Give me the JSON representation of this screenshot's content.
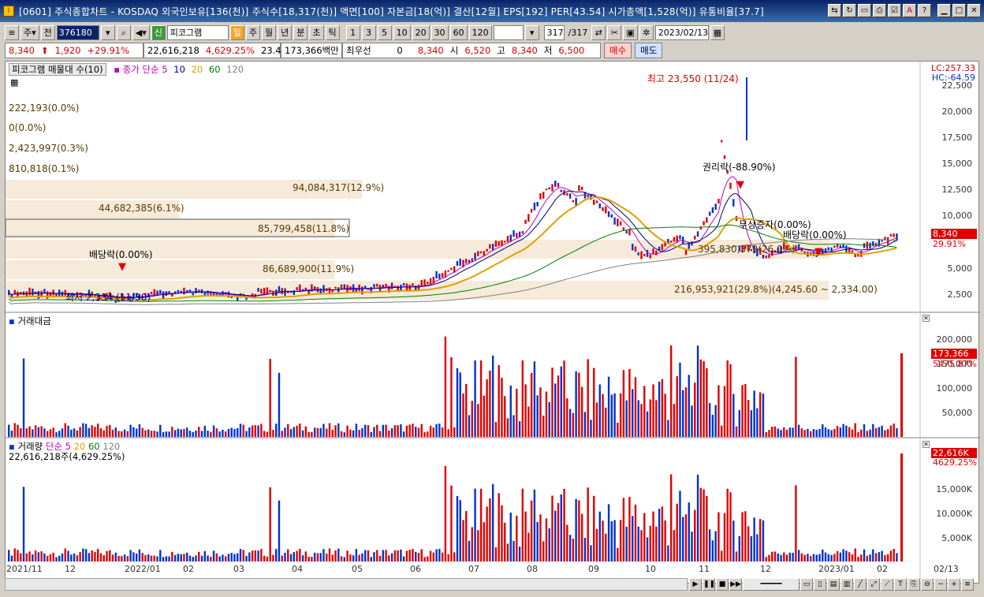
{
  "window": {
    "title": "[0601] 주식종합차트 - KOSDAQ 외국인보유[136(천)] 주식수[18,317(천)] 액면[100] 자본금[18(억)] 결산[12월] EPS[192] PER[43.54] 시가총액[1,528(억)] 유통비율[37.7]"
  },
  "toolbar": {
    "market_label": "주",
    "all_label": "전",
    "code": "376180",
    "program_label": "피코그램",
    "periods": [
      "일",
      "주",
      "월",
      "년",
      "분",
      "초",
      "틱"
    ],
    "intervals": [
      "1",
      "3",
      "5",
      "10",
      "20",
      "30",
      "60",
      "120"
    ],
    "count": "317",
    "count_total": "/317",
    "date": "2023/02/13"
  },
  "quote": {
    "price": "8,340",
    "change": "1,920",
    "change_pct": "+29.91%",
    "volume": "22,616,218",
    "volume_pct": "4,629.25%",
    "turnover": "23.47%",
    "trade_value": "173,366백만",
    "best_bid_label": "최우선",
    "best_bid": "0",
    "current": "8,340",
    "open_label": "시",
    "open": "6,520",
    "high_label": "고",
    "high": "8,340",
    "low_label": "저",
    "low": "6,500",
    "buy_label": "매수",
    "sell_label": "매도"
  },
  "price_panel": {
    "vp_legend": "피코그램 매물대 수(10)",
    "ma_legend": "종가 단순 5",
    "ma_periods": [
      "10",
      "20",
      "60",
      "120"
    ],
    "lc": "LC:257.33",
    "hc": "HC:-64.59",
    "price_badge": "8,340",
    "pct_badge": "29.91%",
    "indicators": [
      "222,193(0.0%)",
      "0(0.0%)",
      "2,423,997(0.3%)",
      "810,818(0.1%)"
    ],
    "volume_profile": [
      {
        "label": "94,084,317(12.9%)",
        "fill": 0.39
      },
      {
        "label": "44,682,385(6.1%)",
        "fill": 0.19
      },
      {
        "label": "85,799,458(11.8%)",
        "fill": 0.36
      },
      {
        "label": "395,830,379(26.0%)",
        "fill": 0.9
      },
      {
        "label": "86,689,900(11.9%)",
        "fill": 0.36
      },
      {
        "label": "216,953,921(29.8%)(4,245.60 ~ 2,334.00)",
        "fill": 0.9
      }
    ],
    "annotations": {
      "high": "최고 23,550 (11/24)",
      "low": "최저 2,334 (11/30)",
      "rights": "권리락(-88.90%)",
      "bonus": "무상증자(0.00%)",
      "dividend1": "배당락(0.00%)",
      "dividend2": "배당락(0.00%)"
    },
    "y_ticks": [
      "22,500",
      "20,000",
      "17,500",
      "15,000",
      "12,500",
      "10,000",
      "5,000",
      "2,500"
    ]
  },
  "value_panel": {
    "title": "거래대금",
    "y_ticks": [
      "200,000",
      "150,000",
      "100,000",
      "50,000"
    ],
    "badge": "173,366",
    "badge_pct": "5475.87%"
  },
  "volume_panel": {
    "title": "거래량",
    "ma_label": "단순 5",
    "ma_periods": [
      "20",
      "60",
      "120"
    ],
    "sub": "22,616,218주(4,629.25%)",
    "y_ticks": [
      "15,000K",
      "10,000K",
      "5,000K"
    ],
    "badge": "22,616K",
    "badge_pct": "4629.25%"
  },
  "x_axis": [
    "2021/11",
    "12",
    "2022/01",
    "02",
    "03",
    "04",
    "05",
    "06",
    "07",
    "08",
    "09",
    "10",
    "11",
    "12",
    "2023/01",
    "02",
    "02/13"
  ],
  "colors": {
    "up": "#e00000",
    "down": "#0033cc",
    "ma5": "#c000c0",
    "ma10": "#000080",
    "ma20": "#e0a000",
    "ma60": "#008000",
    "ma120": "#808080",
    "vp": "#f5e6d3"
  }
}
